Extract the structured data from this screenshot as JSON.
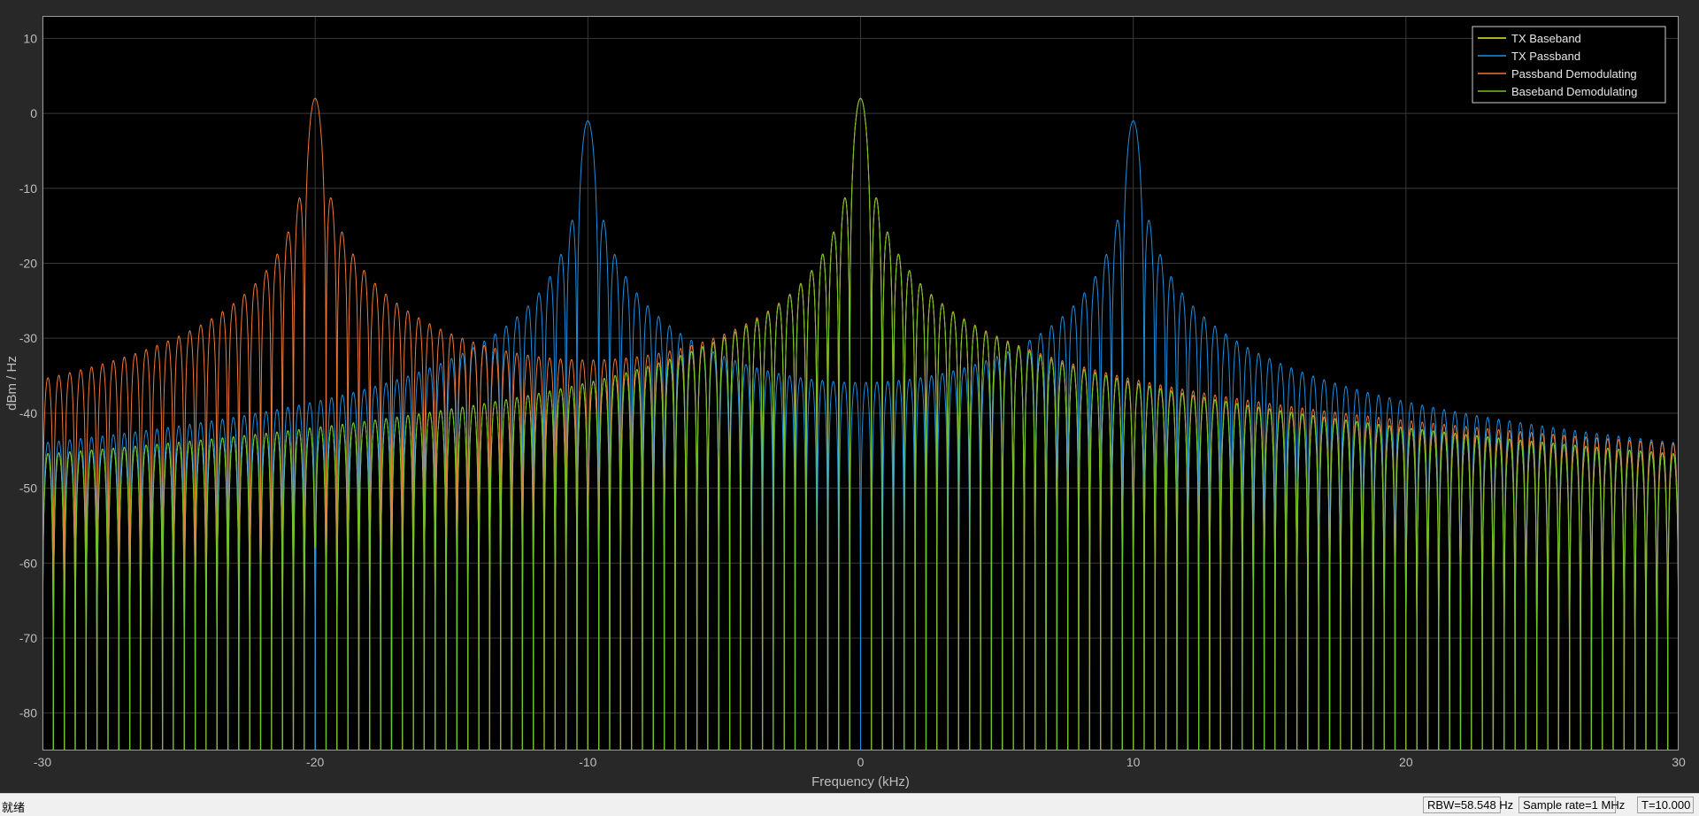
{
  "chart_data": {
    "type": "line",
    "title": "",
    "xlabel": "Frequency (kHz)",
    "ylabel": "dBm / Hz",
    "xlim": [
      -30,
      30
    ],
    "ylim": [
      -85,
      13
    ],
    "xticks": [
      -30,
      -20,
      -10,
      0,
      10,
      20,
      30
    ],
    "yticks": [
      -80,
      -70,
      -60,
      -50,
      -40,
      -30,
      -20,
      -10,
      0,
      10
    ],
    "grid": true,
    "legend_position": "top-right",
    "background": "#000000",
    "sidelobe_spacing_khz": 0.4,
    "series": [
      {
        "name": "TX Baseband",
        "color": "#e8e82a",
        "main_lobes": [
          {
            "center_khz": 0,
            "peak_dbm": 2
          }
        ]
      },
      {
        "name": "TX Passband",
        "color": "#1c8fe0",
        "main_lobes": [
          {
            "center_khz": -10,
            "peak_dbm": -1
          },
          {
            "center_khz": 10,
            "peak_dbm": -1
          }
        ]
      },
      {
        "name": "Passband Demodulating",
        "color": "#f07837",
        "main_lobes": [
          {
            "center_khz": -20,
            "peak_dbm": 2
          },
          {
            "center_khz": 0,
            "peak_dbm": 2
          }
        ]
      },
      {
        "name": "Baseband Demodulating",
        "color": "#6fc52a",
        "main_lobes": [
          {
            "center_khz": -20,
            "peak_dbm": -58
          },
          {
            "center_khz": 0,
            "peak_dbm": 2
          }
        ]
      }
    ]
  },
  "status": {
    "text": "就绪",
    "rbw": "RBW=58.548 Hz",
    "sample_rate": "Sample rate=1 MHz",
    "time": "T=10.000"
  }
}
